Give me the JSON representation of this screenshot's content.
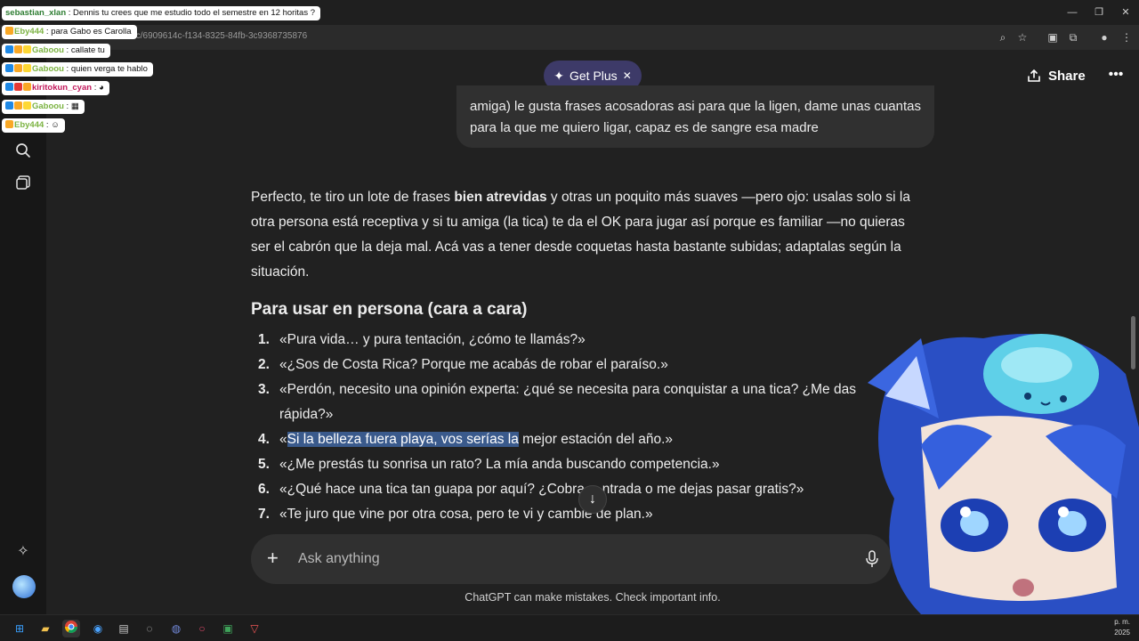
{
  "browser": {
    "url": "/c/6909614c-f134-8325-84fb-3c9368735876"
  },
  "chat_overlay": [
    {
      "user": "sebastian_xlan",
      "text": "Dennis tu crees que me estudio todo el semestre en 12 horitas ?",
      "color": "#2e7d32"
    },
    {
      "user": "Eby444",
      "text": "para Gabo es Carolla",
      "color": "#7cb342"
    },
    {
      "user": "Gaboou",
      "text": "callate tu",
      "color": "#7cb342"
    },
    {
      "user": "Gaboou",
      "text": "quien verga te hablo",
      "color": "#7cb342"
    },
    {
      "user": "kiritokun_cyan",
      "text": "",
      "color": "#c2185b"
    },
    {
      "user": "Gaboou",
      "text": "",
      "color": "#7cb342"
    },
    {
      "user": "Eby444",
      "text": "",
      "color": "#7cb342"
    }
  ],
  "header": {
    "get_plus": "Get Plus",
    "share": "Share"
  },
  "user_message": {
    "text": "amiga) le gusta frases acosadoras asi para que la ligen, dame unas cuantas para la que me quiero ligar, capaz es de sangre esa madre"
  },
  "answer": {
    "intro_1": "Perfecto, te tiro un lote de frases ",
    "intro_bold": "bien atrevidas",
    "intro_2": " y otras un poquito más suaves —pero ojo: usalas solo si la otra persona está receptiva y si tu amiga (la tica) te da el OK para jugar así porque es familiar —no quieras ser el cabrón que la deja mal. Acá vas a tener desde coquetas hasta bastante subidas; adaptalas según la situación.",
    "heading": "Para usar en persona (cara a cara)",
    "items": [
      {
        "num": "1.",
        "text": "«Pura vida… y pura tentación, ¿cómo te llamás?»"
      },
      {
        "num": "2.",
        "text": "«¿Sos de Costa Rica? Porque me acabás de robar el paraíso.»"
      },
      {
        "num": "3.",
        "text": "«Perdón, necesito una opinión experta: ¿qué se necesita para conquistar a una tica? ¿Me das rápida?»"
      },
      {
        "num": "4.",
        "text_selected": "Si la belleza fuera playa, vos serías la",
        "text_pre": "«",
        "text_post": " mejor estación del año.»"
      },
      {
        "num": "5.",
        "text": "«¿Me prestás tu sonrisa un rato? La mía anda buscando competencia.»"
      },
      {
        "num": "6.",
        "text": "«¿Qué hace una tica tan guapa por aquí? ¿Cobra… ntrada o me dejas pasar gratis?»"
      },
      {
        "num": "7.",
        "text": "«Te juro que vine por otra cosa, pero te vi y cambie de plan.»"
      }
    ]
  },
  "composer": {
    "placeholder": "Ask anything"
  },
  "footer": {
    "disclaimer": "ChatGPT can make mistakes. Check important info."
  },
  "taskbar": {
    "time_line1": "p. m.",
    "time_line2": "2025"
  },
  "colors": {
    "background": "#212121",
    "sidebar": "#171717",
    "bubble": "#303030",
    "get_plus": "#3d3a68",
    "selection": "#3a5a8c"
  }
}
